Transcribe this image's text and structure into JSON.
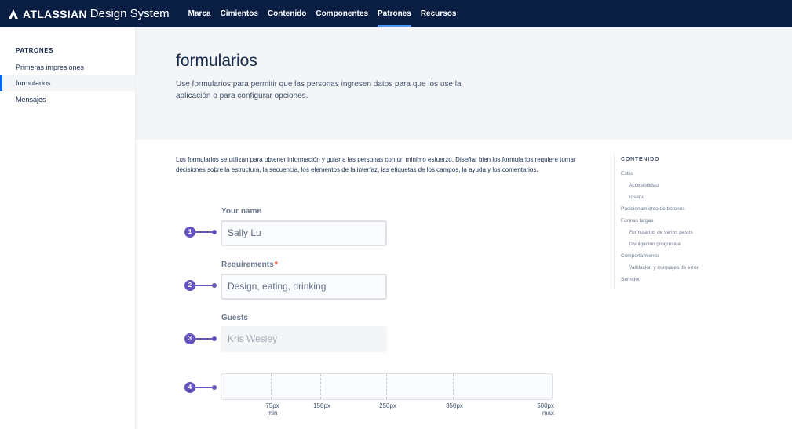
{
  "topnav": {
    "brand": "ATLASSIAN",
    "product": "Design System",
    "links": [
      {
        "label": "Marca"
      },
      {
        "label": "Cimientos"
      },
      {
        "label": "Contenido"
      },
      {
        "label": "Componentes"
      },
      {
        "label": "Patrones",
        "active": true
      },
      {
        "label": "Recursos"
      }
    ],
    "active_underline_color": "#4c9aff"
  },
  "sidebar": {
    "heading": "PATRONES",
    "items": [
      {
        "label": "Primeras impresiones"
      },
      {
        "label": "formularios",
        "active": true
      },
      {
        "label": "Mensajes"
      }
    ]
  },
  "hero": {
    "title": "formularios",
    "description": "Use formularios para permitir que las personas ingresen datos para que los use la aplicación o para configurar opciones."
  },
  "intro": "Los formularios se utilizan para obtener información y guiar a las personas con un mínimo esfuerzo. Diseñar bien los formularios requiere tomar decisiones sobre la estructura, la secuencia, los elementos de la interfaz, las etiquetas de los campos, la ayuda y los comentarios.",
  "form_demo": {
    "fields": [
      {
        "marker": "1",
        "label": "Your name",
        "value": "Sally Lu",
        "required": false
      },
      {
        "marker": "2",
        "label": "Requirements",
        "required_mark": "*",
        "value": "Design, eating, drinking",
        "required": true
      },
      {
        "marker": "3",
        "label": "Guests",
        "value": "Kris Wesley",
        "disabled": true
      }
    ],
    "width_marker": "4",
    "width_scale": [
      {
        "value": "75px",
        "sub": "min"
      },
      {
        "value": "150px"
      },
      {
        "value": "250px"
      },
      {
        "value": "350px"
      },
      {
        "value": "500px",
        "sub": "max"
      }
    ],
    "marker_color": "#6554c0"
  },
  "toc": {
    "title": "CONTENIDO",
    "items": [
      {
        "label": "Estilo"
      },
      {
        "label": "Accesibilidad"
      },
      {
        "label": "Diseño"
      },
      {
        "label": "Posicionamiento de botones"
      },
      {
        "label": "Formas largas"
      },
      {
        "label": "Formularios de varios pasos"
      },
      {
        "label": "Divulgación progresiva"
      },
      {
        "label": "Comportamiento"
      },
      {
        "label": "Validación y mensajes de error"
      },
      {
        "label": "Servidor"
      }
    ]
  }
}
